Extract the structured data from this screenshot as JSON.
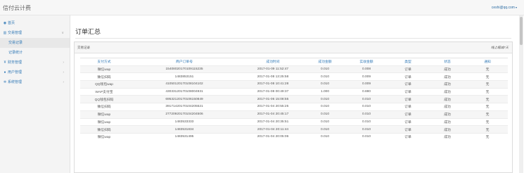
{
  "app": {
    "brand": "信付云计费",
    "user_email": "ceshi@qq.com",
    "user_caret": "▾"
  },
  "sidebar": {
    "items": [
      {
        "label": "首页",
        "icon": "dashboard-icon"
      },
      {
        "label": "交易管理",
        "icon": "bar-chart-icon",
        "chevron": "∨",
        "sub": [
          "交易记录",
          "记录统计"
        ]
      },
      {
        "label": "财务管理",
        "icon": "yen-icon",
        "chevron": "›"
      },
      {
        "label": "用户管理",
        "icon": "user-icon",
        "chevron": "›"
      },
      {
        "label": "系统管理",
        "icon": "gears-icon",
        "chevron": "›"
      }
    ]
  },
  "page": {
    "title": "订单汇总",
    "panel_title": "交易记录",
    "panel_link": "线上缩减7天"
  },
  "table": {
    "headers": [
      "支付方式",
      "商户订单号",
      "成功时间",
      "成功金额",
      "实收金额",
      "类型",
      "状态",
      "通知"
    ],
    "rows": [
      [
        "微信wap",
        "1540802017010911523​5",
        "2017-01-09 11:52:47",
        "0.010",
        "0.008",
        "订单",
        "成功",
        "无"
      ],
      [
        "微信扫码",
        "1483853151",
        "2017-01-08 13:25:58",
        "0.010",
        "0.009",
        "订单",
        "成功",
        "无"
      ],
      [
        "QQ钱包wap",
        "4105012017010810410​2",
        "2017-01-08 10:41:28",
        "0.010",
        "0.009",
        "订单",
        "成功",
        "无"
      ],
      [
        "WAP支付宝",
        "4303312017010800493​1",
        "2017-01-08 00:49:37",
        "1.000",
        "0.880",
        "订单",
        "成功",
        "无"
      ],
      [
        "QQ钱包扫码",
        "6953212017010615084​9",
        "2017-01-06 15:08:55",
        "0.010",
        "0.010",
        "订单",
        "成功",
        "无"
      ],
      [
        "微信扫码",
        "3917142017010420552​1",
        "2017-01-04 20:55:25",
        "0.010",
        "0.010",
        "订单",
        "成功",
        "无"
      ],
      [
        "微信wap",
        "2772092017010420450​6",
        "2017-01-04 20:45:17",
        "0.010",
        "0.010",
        "订单",
        "成功",
        "无"
      ],
      [
        "微信wap",
        "1483533333",
        "2017-01-04 20:35:51",
        "0.010",
        "0.010",
        "订单",
        "成功",
        "无"
      ],
      [
        "微信扫码",
        "1483531834",
        "2017-01-04 20:11:44",
        "0.010",
        "0.010",
        "订单",
        "成功",
        "无"
      ],
      [
        "微信wap",
        "1483531495",
        "2017-01-04 20:05:06",
        "0.010",
        "0.010",
        "订单",
        "成功",
        "无"
      ]
    ]
  }
}
